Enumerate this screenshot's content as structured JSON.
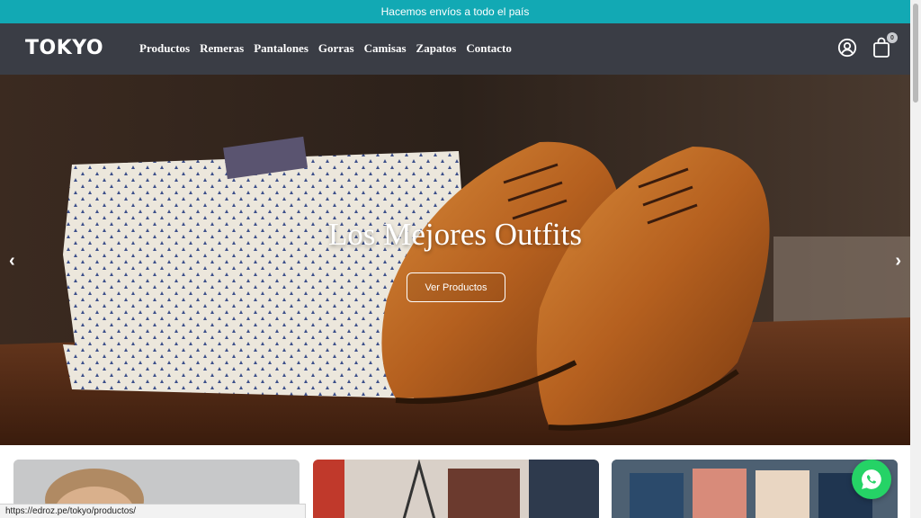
{
  "announcement": "Hacemos envíos a todo el país",
  "brand": "TOKYO",
  "nav": [
    "Productos",
    "Remeras",
    "Pantalones",
    "Gorras",
    "Camisas",
    "Zapatos",
    "Contacto"
  ],
  "cart_count": "0",
  "hero": {
    "title": "Los Mejores Outfits",
    "button": "Ver Productos",
    "prev_arrow": "‹",
    "next_arrow": "›"
  },
  "status_url": "https://edroz.pe/tokyo/productos/",
  "icons": [
    "user-icon",
    "shopping-bag-icon",
    "chevron-left-icon",
    "chevron-right-icon",
    "whatsapp-icon"
  ],
  "colors": {
    "announcement_bg": "#12a9b4",
    "navbar_bg": "#3a3d45",
    "whatsapp": "#25d366"
  }
}
